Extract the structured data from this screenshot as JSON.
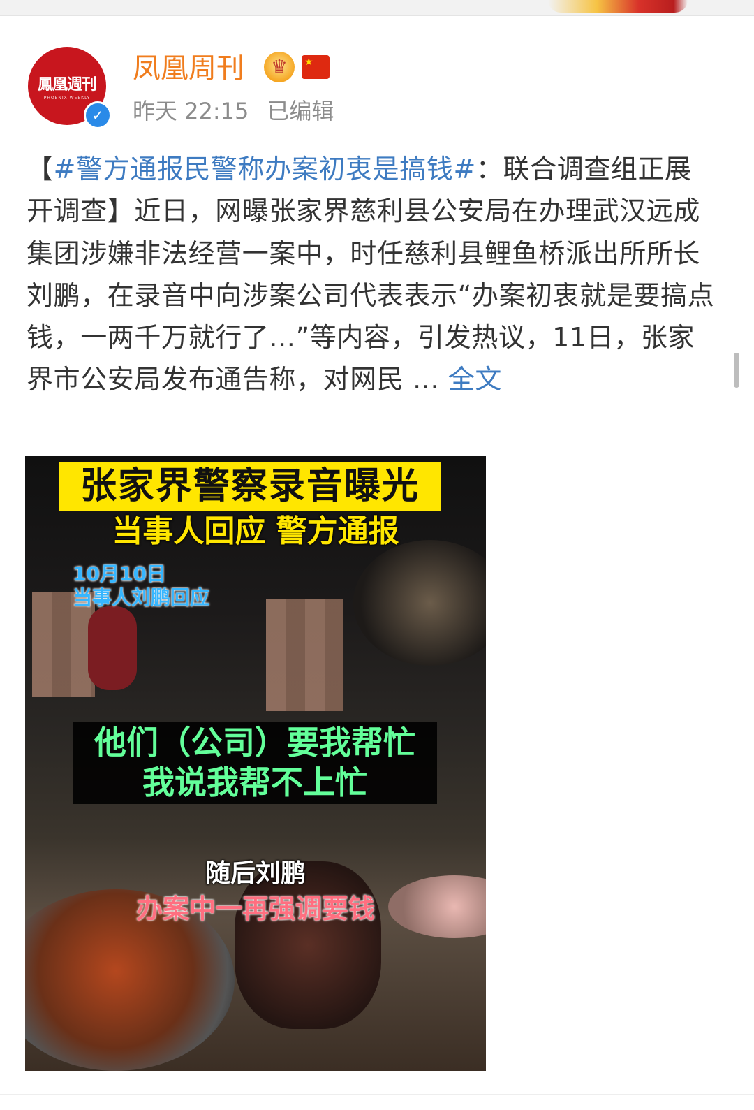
{
  "post": {
    "author": "凤凰周刊",
    "avatar_logo": "鳳凰週刊",
    "avatar_sub": "PHOENIX WEEKLY",
    "time": "昨天 22:15",
    "edited": "已编辑",
    "text_open": "【",
    "topic": "#警方通报民警称办案初衷是搞钱#",
    "text_body": "：联合调查组正展开调查】近日，网曝张家界慈利县公安局在办理武汉远成集团涉嫌非法经营一案中，时任慈利县鲤鱼桥派出所所长刘鹏，在录音中向涉案公司代表表示“办案初衷就是要搞点钱，一两千万就行了...”等内容，引发热议，11日，张家界市公安局发布通告称，对网民 ... ",
    "more_link": "全文"
  },
  "media": {
    "caption_title": "张家界警察录音曝光",
    "caption_subtitle": "当事人回应 警方通报",
    "caption_date": "10月10日",
    "caption_date_sub": "当事人刘鹏回应",
    "caption_quote_line1": "他们（公司）要我帮忙",
    "caption_quote_line2": "我说我帮不上忙",
    "caption_after": "随后刘鹏",
    "caption_money": "办案中一再强调要钱"
  },
  "icons": {
    "crown": "crown-badge-icon",
    "flag": "china-flag-icon",
    "verified": "verified-badge-icon"
  },
  "colors": {
    "username": "#f07d1e",
    "link": "#3e7bc1",
    "verified": "#2a8ae8",
    "caption_yellow": "#ffe600",
    "caption_green": "#63ff9a"
  }
}
